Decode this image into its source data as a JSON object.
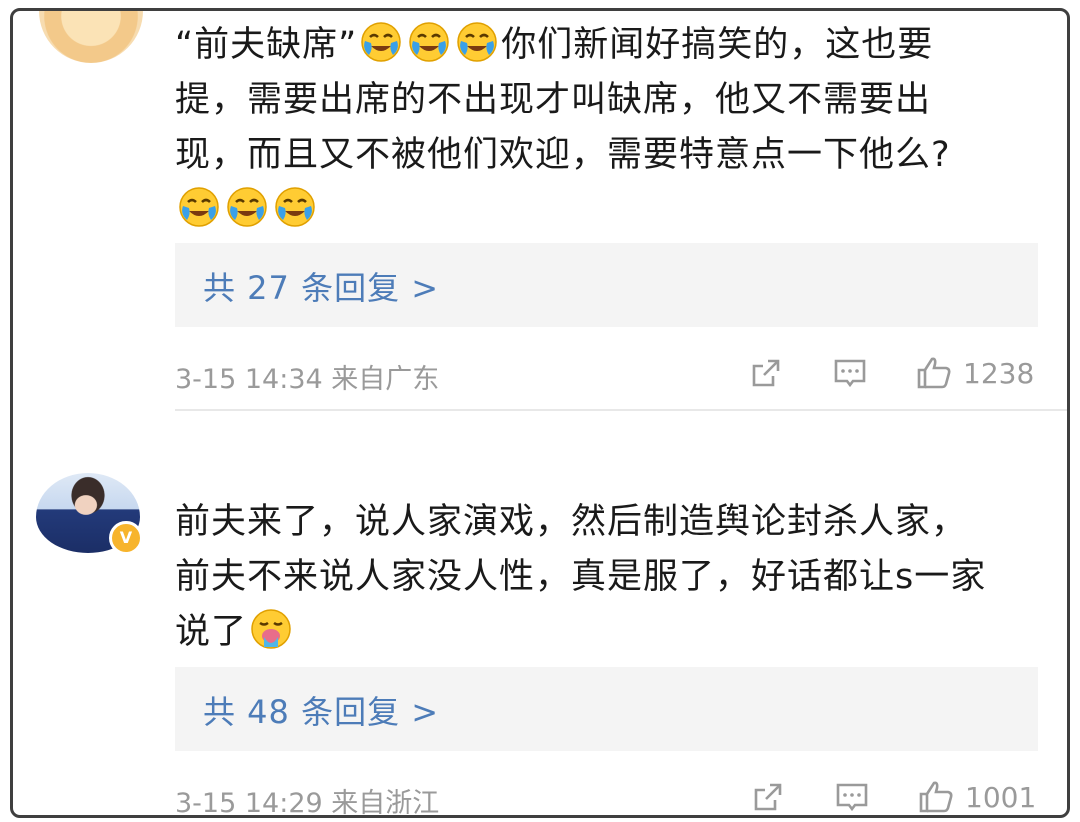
{
  "comments": [
    {
      "parts": [
        "“前夫缺席”",
        "你们新闻好搞笑的，这也要提，需要出席的不出现才叫缺席，他又不需要出现，而且又不被他们欢迎，需要特意点一下他么?"
      ],
      "reply_label": "共 27 条回复 >",
      "time": "3-15 14:34 来自广东",
      "likes": "1238",
      "avatar_icon": "avatar-icon",
      "emoji": "laughing-crying-emoji"
    },
    {
      "parts": [
        "前夫来了，说人家演戏，然后制造舆论封杀人家，前夫不来说人家没人性，真是服了，好话都让s一家说了"
      ],
      "reply_label": "共 48 条回复 >",
      "time": "3-15 14:29 来自浙江",
      "likes": "1001",
      "badge": "V",
      "emoji": "vomiting-emoji"
    }
  ],
  "icons": {
    "share": "share-icon",
    "comment": "comment-icon",
    "like": "thumbs-up-icon"
  },
  "colors": {
    "link": "#4d7cb8",
    "meta": "#9a9a9a",
    "reply_bg": "#f4f4f4",
    "badge": "#f7b42c"
  }
}
